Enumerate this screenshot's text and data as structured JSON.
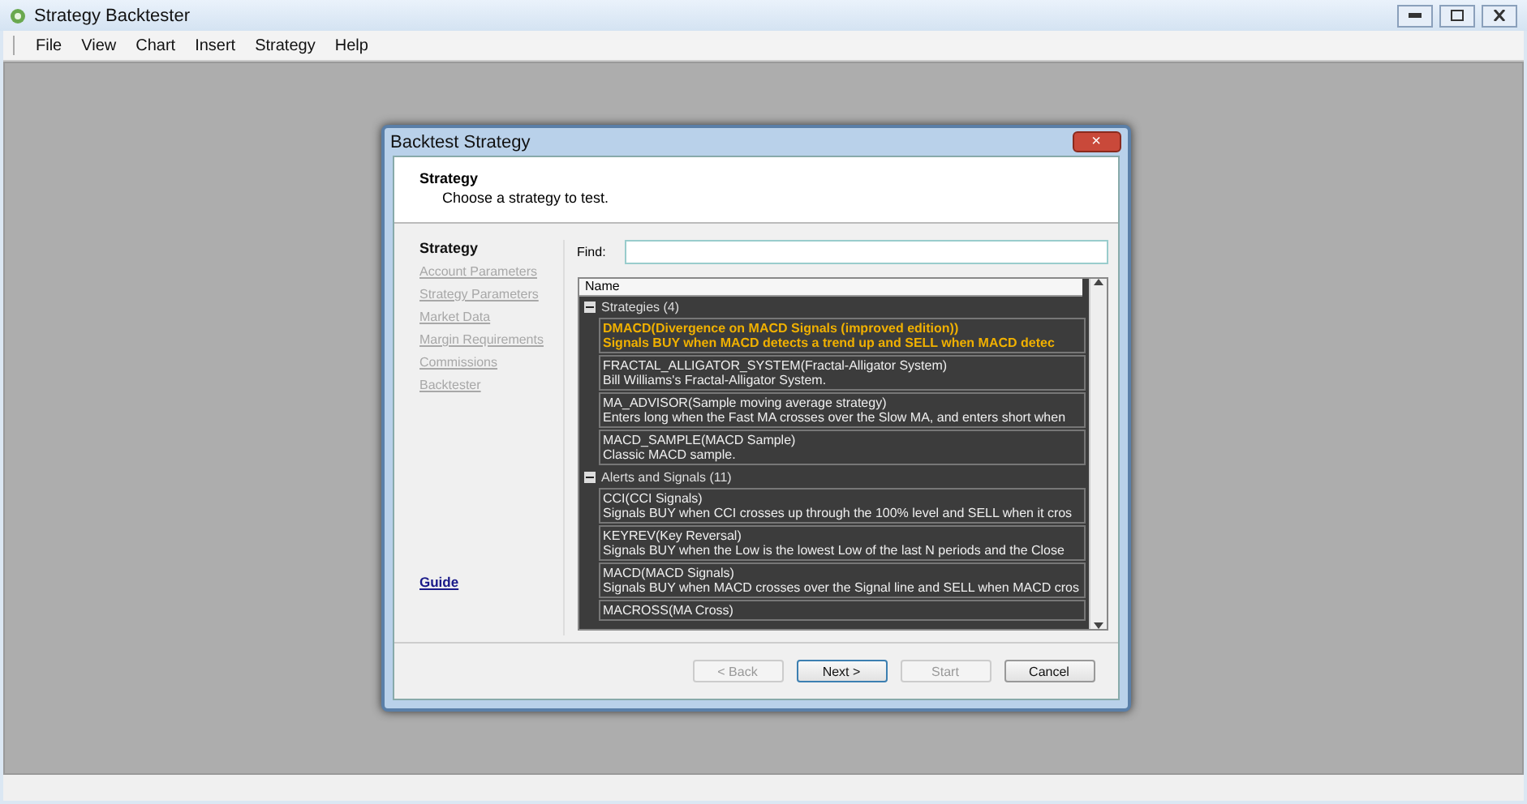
{
  "window": {
    "title": "Strategy Backtester"
  },
  "menu": [
    "File",
    "View",
    "Chart",
    "Insert",
    "Strategy",
    "Help"
  ],
  "dialog": {
    "title": "Backtest Strategy",
    "close": "×",
    "header": {
      "title": "Strategy",
      "subtitle": "Choose a strategy to test."
    },
    "steps": [
      {
        "label": "Strategy",
        "selected": true
      },
      {
        "label": "Account Parameters",
        "selected": false
      },
      {
        "label": "Strategy Parameters",
        "selected": false
      },
      {
        "label": "Market Data",
        "selected": false
      },
      {
        "label": "Margin Requirements",
        "selected": false
      },
      {
        "label": "Commissions",
        "selected": false
      },
      {
        "label": "Backtester",
        "selected": false
      }
    ],
    "guide": "Guide",
    "find": {
      "label": "Find:"
    },
    "list": {
      "column": "Name",
      "groups": [
        {
          "label": "Strategies (4)",
          "expanded": true,
          "items": [
            {
              "name": "DMACD(Divergence on MACD Signals (improved edition))",
              "description": "Signals BUY when MACD detects a trend up and SELL when MACD detec",
              "selected": true
            },
            {
              "name": "FRACTAL_ALLIGATOR_SYSTEM(Fractal-Alligator System)",
              "description": "Bill Williams's Fractal-Alligator System.",
              "selected": false
            },
            {
              "name": "MA_ADVISOR(Sample moving average strategy)",
              "description": "Enters long when the Fast MA crosses over the Slow MA, and enters short when",
              "selected": false
            },
            {
              "name": "MACD_SAMPLE(MACD Sample)",
              "description": "Classic MACD sample.",
              "selected": false
            }
          ]
        },
        {
          "label": "Alerts and Signals (11)",
          "expanded": true,
          "items": [
            {
              "name": "CCI(CCI Signals)",
              "description": "Signals BUY when CCI crosses up through the 100% level and SELL when it cros",
              "selected": false
            },
            {
              "name": "KEYREV(Key Reversal)",
              "description": "Signals BUY when the Low is the lowest Low of the last N periods and the Close",
              "selected": false
            },
            {
              "name": "MACD(MACD Signals)",
              "description": "Signals BUY when MACD crosses over the Signal line and SELL when MACD cros",
              "selected": false
            },
            {
              "name": "MACROSS(MA Cross)",
              "selected": false
            }
          ]
        }
      ]
    },
    "buttons": [
      {
        "label": "< Back",
        "disabled": true,
        "default": false
      },
      {
        "label": "Next >",
        "disabled": false,
        "default": true
      },
      {
        "label": "Start",
        "disabled": true,
        "default": false
      },
      {
        "label": "Cancel",
        "disabled": false,
        "default": false
      }
    ]
  }
}
